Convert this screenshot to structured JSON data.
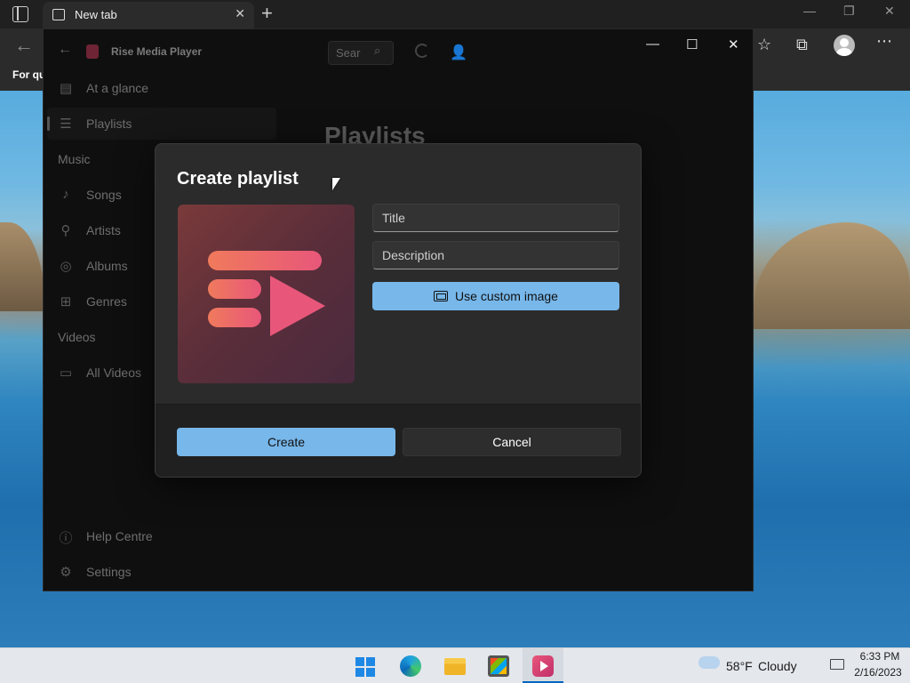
{
  "browser": {
    "tab_title": "New tab",
    "bookmark_text": "For qu"
  },
  "app": {
    "title": "Rise Media Player",
    "search_placeholder": "Sear",
    "nav": {
      "at_a_glance": "At a glance",
      "playlists": "Playlists",
      "music_section": "Music",
      "songs": "Songs",
      "artists": "Artists",
      "albums": "Albums",
      "genres": "Genres",
      "videos_section": "Videos",
      "all_videos": "All Videos",
      "help": "Help Centre",
      "settings": "Settings"
    },
    "page_heading": "Playlists"
  },
  "dialog": {
    "title": "Create playlist",
    "title_placeholder": "Title",
    "description_placeholder": "Description",
    "custom_image_label": "Use custom image",
    "create_label": "Create",
    "cancel_label": "Cancel"
  },
  "taskbar": {
    "temperature": "58°F",
    "condition": "Cloudy",
    "time": "6:33 PM",
    "date": "2/16/2023"
  },
  "colors": {
    "accent": "#77b7ea",
    "playlist_gradient_start": "#f07a5c",
    "playlist_gradient_end": "#e8577a"
  }
}
